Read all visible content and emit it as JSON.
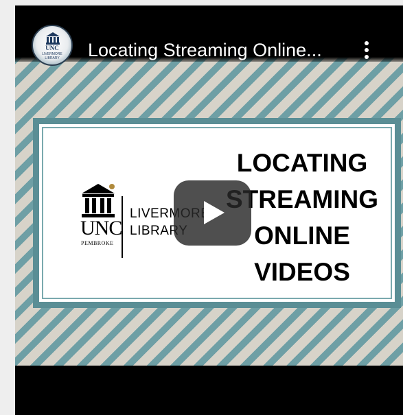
{
  "video": {
    "title": "Locating Streaming Online...",
    "channel_avatar_text": {
      "line1": "UNC",
      "line2": "LIVERMORE",
      "line3": "LIBRARY"
    },
    "more_icon": "more-vertical-icon",
    "play_icon": "play-icon"
  },
  "thumbnail": {
    "logo": {
      "unc": "UNC",
      "pembroke": "PEMBROKE",
      "line1": "LIVERMORE",
      "line2": "LIBRARY"
    },
    "headline": [
      "LOCATING",
      "STREAMING",
      "ONLINE",
      "VIDEOS"
    ]
  },
  "colors": {
    "stripe_light": "#d7d3c9",
    "stripe_teal": "#6e9fa5",
    "card_border": "#5a8e95",
    "player_bg": "#000000"
  }
}
